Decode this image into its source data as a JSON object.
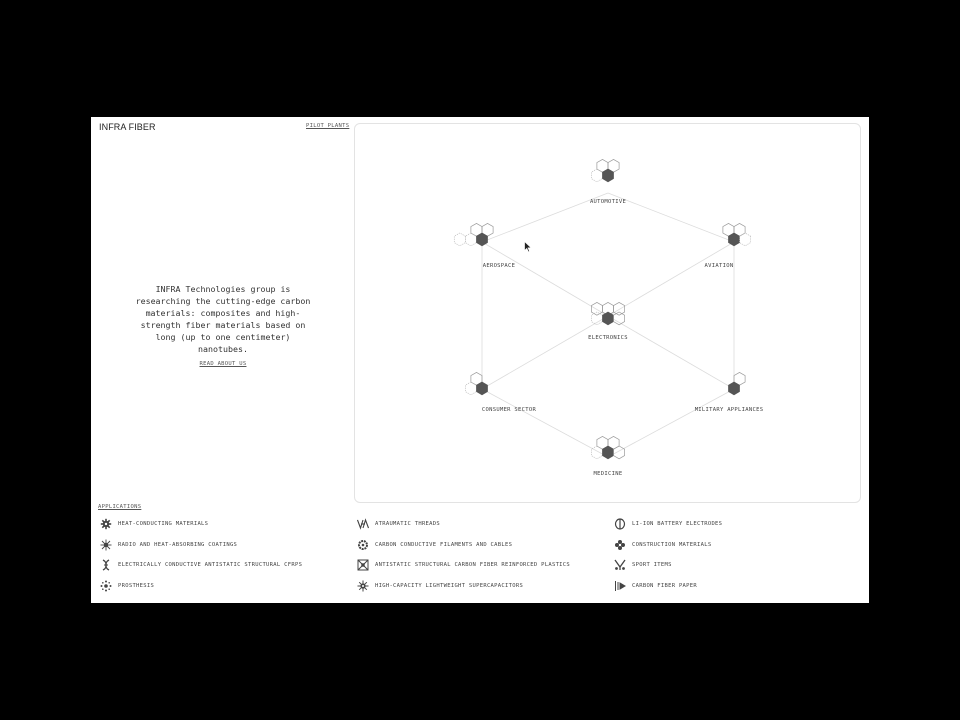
{
  "header": {
    "brand": "INFRA FIBER",
    "pilot_plants_link": "PILOT PLANTS"
  },
  "intro": {
    "text": "INFRA Technologies group is researching the cutting-edge carbon materials: composites and high-strength fiber materials based on long (up to one centimeter) nanotubes.",
    "read_link": "READ ABOUT US"
  },
  "diagram": {
    "nodes": {
      "automotive": "AUTOMOTIVE",
      "aerospace": "AEROSPACE",
      "aviation": "AVIATION",
      "electronics": "ELECTRONICS",
      "consumer": "CONSUMER SECTOR",
      "military": "MILITARY APPLIANCES",
      "medicine": "MEDICINE"
    }
  },
  "applications": {
    "title": "APPLICATIONS",
    "col1": [
      {
        "label": "HEAT-CONDUCTING MATERIALS",
        "icon": "gear-icon"
      },
      {
        "label": "RADIO AND HEAT-ABSORBING COATINGS",
        "icon": "burst-icon"
      },
      {
        "label": "ELECTRICALLY CONDUCTIVE ANTISTATIC STRUCTURAL CFRPS",
        "icon": "helix-icon"
      },
      {
        "label": "PROSTHESIS",
        "icon": "dots-icon"
      }
    ],
    "col2": [
      {
        "label": "ATRAUMATIC THREADS",
        "icon": "threads-icon"
      },
      {
        "label": "CARBON CONDUCTIVE FILAMENTS AND CABLES",
        "icon": "ring-icon"
      },
      {
        "label": "ANTISTATIC STRUCTURAL CARBON FIBER REINFORCED PLASTICS",
        "icon": "grid-icon"
      },
      {
        "label": "HIGH-CAPACITY LIGHTWEIGHT SUPERCAPACITORS",
        "icon": "spark-icon"
      }
    ],
    "col3": [
      {
        "label": "LI-ION BATTERY ELECTRODES",
        "icon": "battery-icon"
      },
      {
        "label": "CONSTRUCTION MATERIALS",
        "icon": "flower-icon"
      },
      {
        "label": "SPORT ITEMS",
        "icon": "racket-icon"
      },
      {
        "label": "CARBON FIBER PAPER",
        "icon": "paper-icon"
      }
    ]
  }
}
